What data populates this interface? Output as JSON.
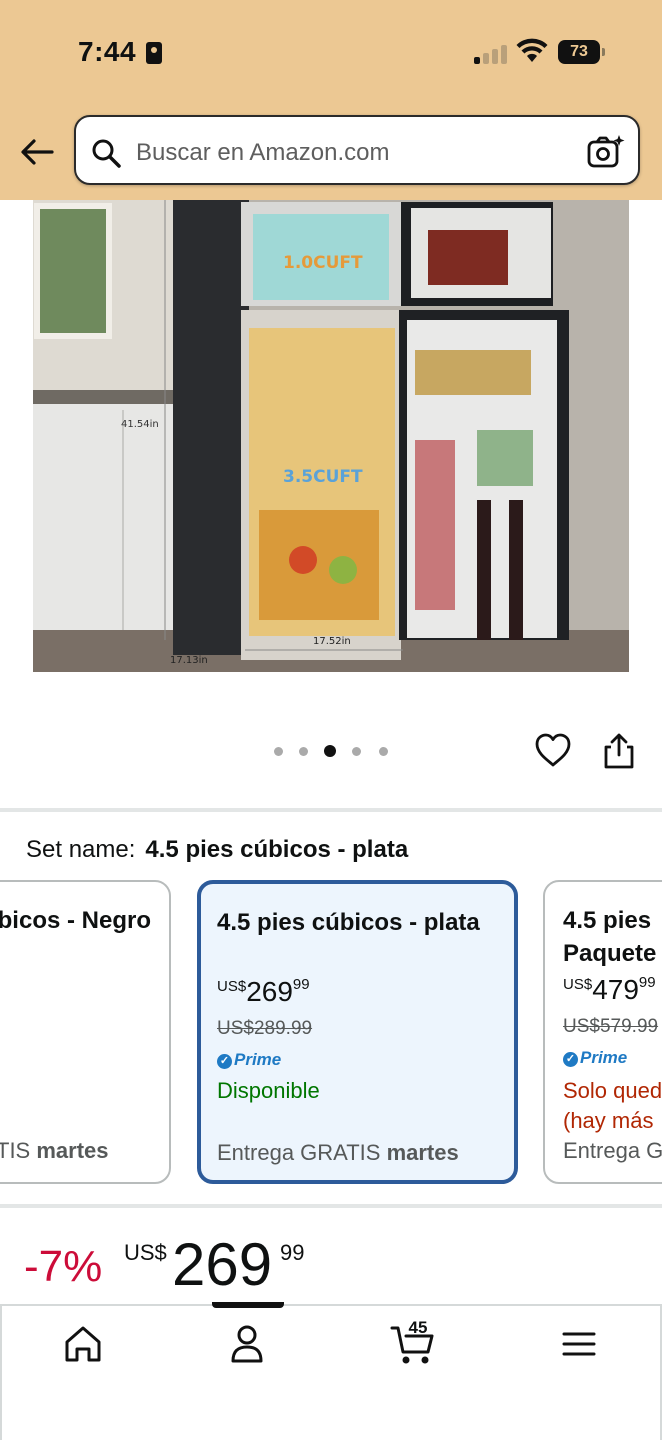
{
  "status_bar": {
    "time": "7:44",
    "battery": "73"
  },
  "search": {
    "placeholder": "Buscar en Amazon.com"
  },
  "product_image": {
    "labels": {
      "top_freezer": "1.0CUFT",
      "main": "3.5CUFT",
      "height": "41.54in",
      "width": "17.52in",
      "depth": "17.13in"
    }
  },
  "gallery": {
    "total": 5,
    "active_index": 2
  },
  "set_name": {
    "label": "Set name:",
    "value": "4.5 pies cúbicos - plata"
  },
  "options": [
    {
      "title": "bicos - Negro",
      "delivery_prefix": "TIS",
      "delivery_day": "martes"
    },
    {
      "title": "4.5 pies cúbicos - plata",
      "currency": "US$",
      "price_whole": "269",
      "price_cents": "99",
      "old_price": "US$289.99",
      "prime": "Prime",
      "availability": "Disponible",
      "delivery_prefix": "Entrega GRATIS",
      "delivery_day": "martes"
    },
    {
      "title_line1": "4.5 pies",
      "title_line2": "Paquete",
      "currency": "US$",
      "price_whole": "479",
      "price_cents": "99",
      "old_price": "US$579.99",
      "prime": "Prime",
      "availability_line1": "Solo qued",
      "availability_line2": "(hay más",
      "delivery_prefix": "Entrega G"
    }
  ],
  "price": {
    "discount": "-7%",
    "currency": "US$",
    "whole": "269",
    "cents": "99"
  },
  "tabbar": {
    "cart_count": "45"
  }
}
